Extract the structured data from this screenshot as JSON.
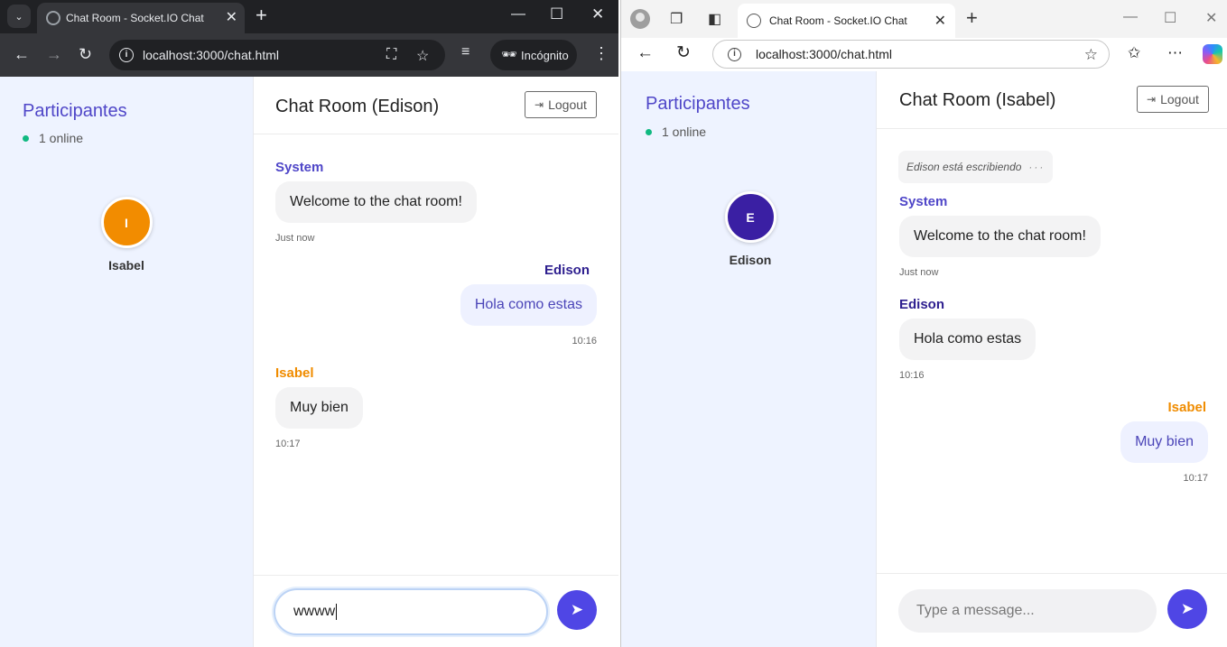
{
  "left_window": {
    "tab_title": "Chat Room - Socket.IO Chat",
    "url": "localhost:3000/chat.html",
    "incognito_label": "Incógnito",
    "app": {
      "sidebar_title": "Participantes",
      "online_count": "1 online",
      "participant": {
        "initial": "I",
        "name": "Isabel",
        "color": "#f28c00"
      },
      "chat_title": "Chat Room (Edison)",
      "logout_label": "Logout",
      "messages": [
        {
          "sender": "System",
          "text": "Welcome to the chat room!",
          "time": "Just now"
        },
        {
          "sender": "Edison",
          "text": "Hola como estas",
          "time": "10:16"
        },
        {
          "sender": "Isabel",
          "text": "Muy bien",
          "time": "10:17"
        }
      ],
      "input_value": "wwww"
    }
  },
  "right_window": {
    "tab_title": "Chat Room - Socket.IO Chat",
    "url": "localhost:3000/chat.html",
    "app": {
      "sidebar_title": "Participantes",
      "online_count": "1 online",
      "participant": {
        "initial": "E",
        "name": "Edison",
        "color": "#3a1fa3"
      },
      "chat_title": "Chat Room (Isabel)",
      "logout_label": "Logout",
      "typing_indicator": "Edison está escribiendo",
      "messages": [
        {
          "sender": "System",
          "text": "Welcome to the chat room!",
          "time": "Just now"
        },
        {
          "sender": "Edison",
          "text": "Hola como estas",
          "time": "10:16"
        },
        {
          "sender": "Isabel",
          "text": "Muy bien",
          "time": "10:17"
        }
      ],
      "input_placeholder": "Type a message..."
    }
  },
  "colors": {
    "accent": "#4f46e5",
    "sidebar_bg": "#eef3ff",
    "online_dot": "#10b981",
    "isabel": "#f08c00",
    "edison": "#2e1f8f"
  }
}
